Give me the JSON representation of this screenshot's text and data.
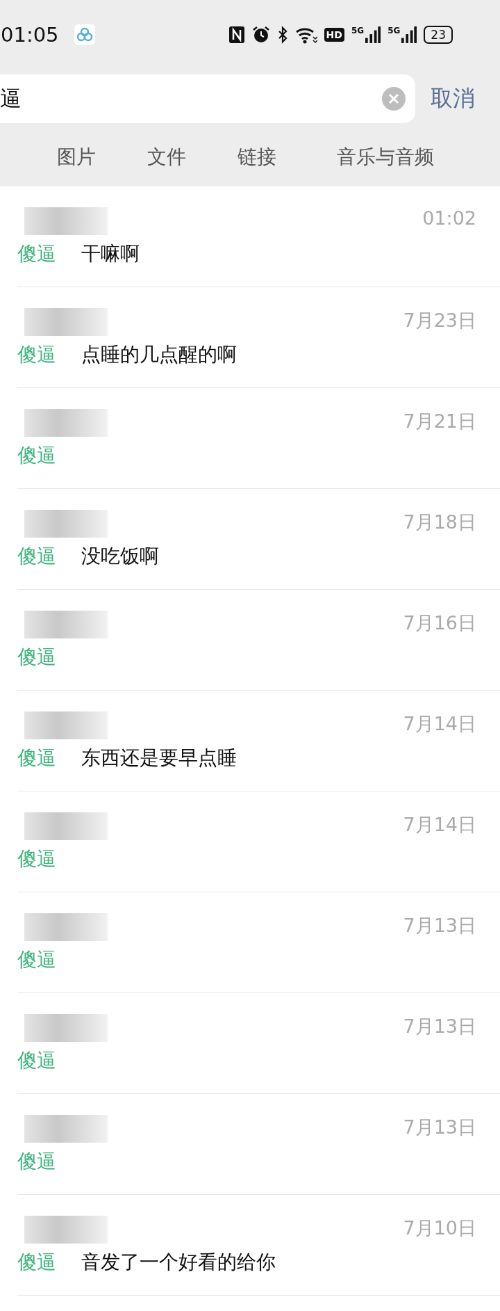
{
  "status_bar": {
    "time": "01:05",
    "hd_label": "HD",
    "network_labels": [
      "5G",
      "5G"
    ],
    "battery": "23"
  },
  "search": {
    "value": "逼",
    "cancel": "取消"
  },
  "tabs": [
    {
      "label": "图片",
      "selected": false
    },
    {
      "label": "文件",
      "selected": false
    },
    {
      "label": "链接",
      "selected": false
    },
    {
      "label": "音乐与音频",
      "selected": false
    }
  ],
  "results": [
    {
      "keyword": "傻逼",
      "message": "干嘛啊",
      "time": "01:02"
    },
    {
      "keyword": "傻逼",
      "message": "点睡的几点醒的啊",
      "time": "7月23日"
    },
    {
      "keyword": "傻逼",
      "time": "7月21日"
    },
    {
      "keyword": "傻逼",
      "message": "没吃饭啊",
      "time": "7月18日"
    },
    {
      "keyword": "傻逼",
      "time": "7月16日"
    },
    {
      "keyword": "傻逼",
      "message": "东西还是要早点睡",
      "time": "7月14日"
    },
    {
      "keyword": "傻逼",
      "time": "7月14日"
    },
    {
      "keyword": "傻逼",
      "time": "7月13日"
    },
    {
      "keyword": "傻逼",
      "time": "7月13日"
    },
    {
      "keyword": "傻逼",
      "time": "7月13日"
    },
    {
      "keyword": "傻逼",
      "message": "音发了一个好看的给你",
      "time": "7月10日"
    }
  ]
}
